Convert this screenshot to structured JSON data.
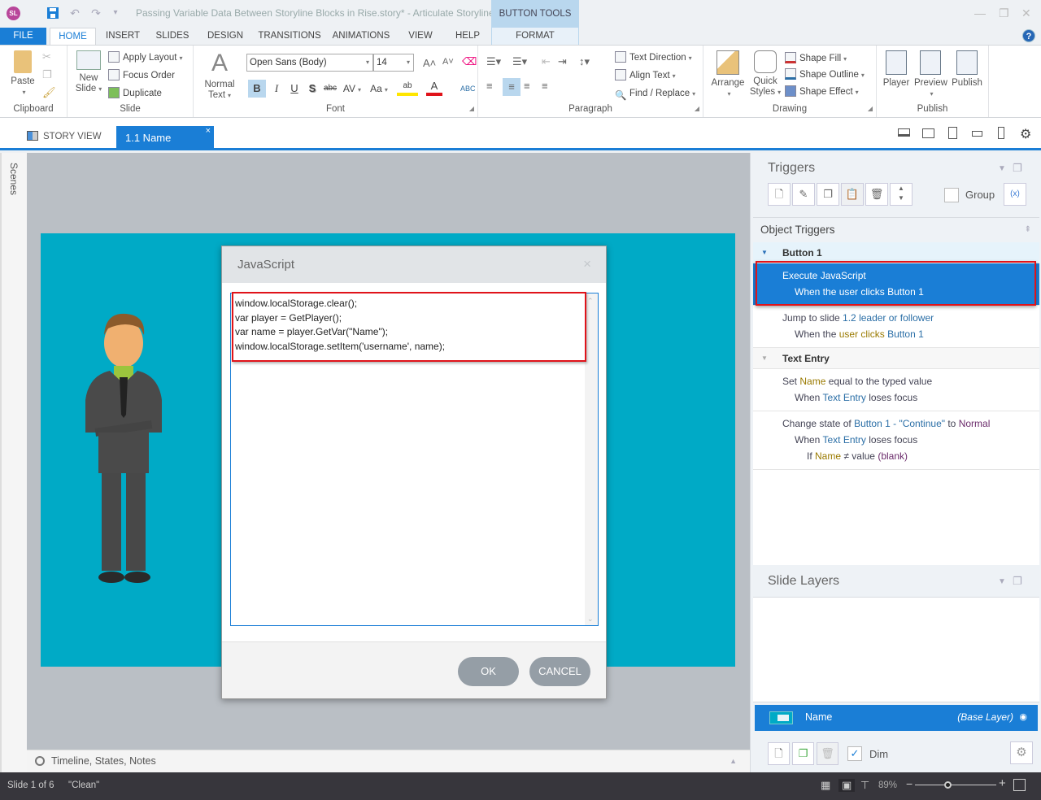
{
  "titlebar": {
    "app_badge": "SL",
    "title": "Passing Variable Data Between Storyline Blocks in Rise.story* - Articulate Storyline",
    "context_tab_header": "BUTTON TOOLS",
    "minimize": "—",
    "restore": "❐",
    "close": "✕"
  },
  "ribbon_tabs": [
    "FILE",
    "HOME",
    "INSERT",
    "SLIDES",
    "DESIGN",
    "TRANSITIONS",
    "ANIMATIONS",
    "VIEW",
    "HELP",
    "FORMAT"
  ],
  "ribbon": {
    "clipboard": {
      "paste": "Paste",
      "label": "Clipboard"
    },
    "slide": {
      "new_slide": "New Slide",
      "apply_layout": "Apply Layout",
      "focus_order": "Focus Order",
      "duplicate": "Duplicate",
      "label": "Slide"
    },
    "text_style": {
      "normal_text": "Normal Text"
    },
    "font": {
      "family": "Open Sans (Body)",
      "size": "14",
      "bold": "B",
      "italic": "I",
      "underline": "U",
      "shadow": "S",
      "strike": "abc",
      "spacing": "AV",
      "case": "Aa",
      "label": "Font"
    },
    "paragraph": {
      "text_direction": "Text Direction",
      "align_text": "Align Text",
      "find_replace": "Find / Replace",
      "label": "Paragraph"
    },
    "drawing": {
      "arrange": "Arrange",
      "quick_styles": "Quick Styles",
      "shape_fill": "Shape Fill",
      "shape_outline": "Shape Outline",
      "shape_effect": "Shape Effect",
      "label": "Drawing"
    },
    "publish": {
      "player": "Player",
      "preview": "Preview",
      "publish": "Publish",
      "label": "Publish"
    }
  },
  "doc_tabs": {
    "story_view": "STORY VIEW",
    "slide_tab": "1.1 Name",
    "close": "×"
  },
  "scenes_label": "Scenes",
  "timeline_label": "Timeline, States, Notes",
  "dialog": {
    "title": "JavaScript",
    "close": "×",
    "code_lines": [
      "window.localStorage.clear();",
      "var player = GetPlayer();",
      "var name = player.GetVar(\"Name\");",
      "window.localStorage.setItem('username', name);"
    ],
    "ok": "OK",
    "cancel": "CANCEL"
  },
  "triggers_panel": {
    "title": "Triggers",
    "group_label": "Group",
    "var_button": "(x)",
    "section": "Object Triggers",
    "objects": [
      {
        "name": "Button 1",
        "triggers": [
          {
            "action": "Execute JavaScript",
            "when_prefix": "When the user clicks",
            "when_object": "Button 1",
            "selected": true
          },
          {
            "action_prefix": "Jump to slide",
            "action_target": "1.2 leader or follower",
            "when_prefix": "When the",
            "when_event": "user clicks",
            "when_object": "Button 1"
          }
        ]
      },
      {
        "name": "Text Entry",
        "triggers": [
          {
            "action_prefix": "Set",
            "variable": "Name",
            "action_suffix": "equal to the typed value",
            "when_prefix": "When",
            "when_object": "Text Entry",
            "when_event": "loses focus"
          },
          {
            "action_prefix": "Change state of",
            "object": "Button 1 - \"Continue\"",
            "to": "to",
            "state": "Normal",
            "when_prefix": "When",
            "when_object": "Text Entry",
            "when_event": "loses focus",
            "cond_if": "If",
            "cond_var": "Name",
            "cond_op": "≠ value",
            "cond_val": "(blank)"
          }
        ]
      }
    ]
  },
  "layers_panel": {
    "title": "Slide Layers",
    "base_layer_name": "Name",
    "base_layer_tag": "(Base Layer)",
    "dim_label": "Dim",
    "dim_checked": true
  },
  "statusbar": {
    "slide_count": "Slide 1 of 6",
    "theme": "\"Clean\"",
    "zoom": "89%",
    "zoom_fraction": 0.4
  },
  "colors": {
    "accent": "#1a7ed6",
    "slide_bg": "#00aac6",
    "highlight": "#e0131a"
  }
}
